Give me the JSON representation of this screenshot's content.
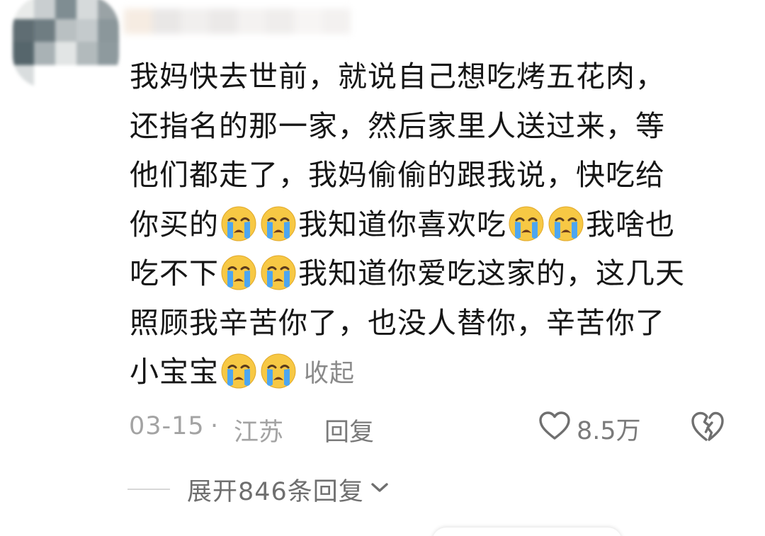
{
  "comment": {
    "lines": [
      [
        {
          "t": "text",
          "v": "我妈快去世前，就说自己想吃烤五花肉，"
        }
      ],
      [
        {
          "t": "text",
          "v": "还指名的那一家，然后家里人送过来，等"
        }
      ],
      [
        {
          "t": "text",
          "v": "他们都走了，我妈偷偷的跟我说，快吃给"
        }
      ],
      [
        {
          "t": "text",
          "v": "你买的"
        },
        {
          "t": "emoji"
        },
        {
          "t": "emoji"
        },
        {
          "t": "text",
          "v": "我知道你喜欢吃"
        },
        {
          "t": "emoji"
        },
        {
          "t": "emoji"
        },
        {
          "t": "text",
          "v": "我啥也"
        }
      ],
      [
        {
          "t": "text",
          "v": "吃不下"
        },
        {
          "t": "emoji"
        },
        {
          "t": "emoji"
        },
        {
          "t": "text",
          "v": "我知道你爱吃这家的，这几天"
        }
      ],
      [
        {
          "t": "text",
          "v": "照顾我辛苦你了，也没人替你，辛苦你了"
        }
      ],
      [
        {
          "t": "text",
          "v": "小宝宝"
        },
        {
          "t": "emoji"
        },
        {
          "t": "emoji"
        },
        {
          "t": "collapse"
        }
      ]
    ],
    "emoji_icon": "loudly-crying-face-icon",
    "collapse_label": "收起"
  },
  "meta": {
    "date": "03-15",
    "separator": "·",
    "region": "江苏",
    "reply_label": "回复",
    "like_count": "8.5万"
  },
  "replies": {
    "expand_label": "展开846条回复"
  },
  "colors": {
    "text": "#161616",
    "meta": "#a3a3a3",
    "secondary": "#7a7a7a",
    "emoji_face": "#f7c844",
    "emoji_tears": "#4da6f0"
  }
}
